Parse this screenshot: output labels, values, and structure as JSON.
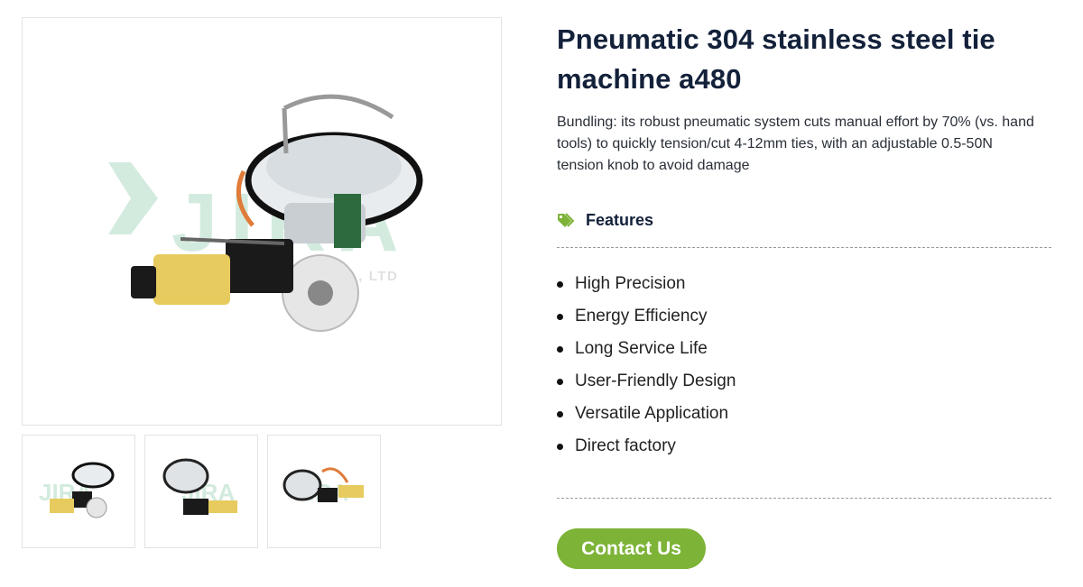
{
  "gallery": {
    "main_alt": "Pneumatic 304 stainless steel tie machine a480",
    "watermark_brand": "JIRA",
    "watermark_company": "YUYAO JIRA LINE CO., LTD",
    "thumbnails": [
      {
        "label": "thumbnail 1"
      },
      {
        "label": "thumbnail 2"
      },
      {
        "label": "thumbnail 3"
      }
    ]
  },
  "product": {
    "title": "Pneumatic 304 stainless steel tie machine a480",
    "description": "Bundling: its robust pneumatic system cuts manual effort by 70% (vs. hand tools) to quickly tension/cut 4-12mm ties, with an adjustable 0.5-50N tension knob to avoid damage"
  },
  "features": {
    "heading": "Features",
    "icon": "tags-icon",
    "items": [
      "High Precision",
      "Energy Efficiency",
      "Long Service Life",
      "User-Friendly Design",
      "Versatile Application",
      "Direct factory"
    ]
  },
  "cta": {
    "label": "Contact Us"
  },
  "colors": {
    "accent": "#7db337",
    "title": "#13213a",
    "body": "#2a2f38"
  }
}
